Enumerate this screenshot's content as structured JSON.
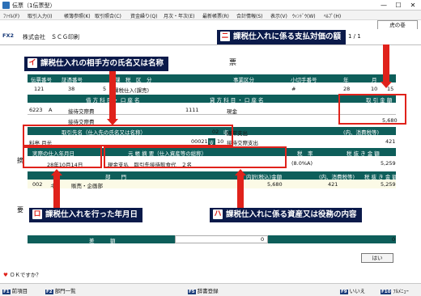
{
  "window": {
    "title": "伝票（1伝票型）",
    "min_glyph": "—",
    "max_glyph": "☐",
    "close_glyph": "✕"
  },
  "menu": [
    "ﾌｧｲﾙ(F)",
    "取引入力(I)",
    "帳簿参照(K)",
    "取引照合(C)",
    "資金繰り(Q)",
    "月次・年次(E)",
    "最新帳票(R)",
    "合計情報(S)",
    "表示(V)",
    "ｳｨﾝﾄﾞｳ(W)",
    "ﾍﾙﾌﾟ(H)"
  ],
  "tab_label": "虎の巻",
  "header": {
    "app_code": "FX2",
    "company": "株式会社　ＳＣＧ印刷",
    "voucher_no": "1 / 1"
  },
  "form": {
    "title": "票",
    "row1_headers": [
      "伝票番号",
      "証憑番号",
      "課　税　区　分",
      "事業区分",
      "小切手番号",
      "年",
      "月"
    ],
    "row1_values": [
      "121",
      "38",
      "5",
      "課税仕入(課売)",
      "#",
      "28",
      "10",
      "15"
    ],
    "debit_header": "借 方 科 目 ・ 口 座 名",
    "credit_header": "貸 方 科 目 ・ 口 座 名",
    "amount_header": "取 引 金 額",
    "debit_code": "6223",
    "debit_flag": "A",
    "debit_name": "接待交際費",
    "debit_sub": "接待交際費",
    "credit_code": "1111",
    "credit_name": "現金",
    "amount": "5,680",
    "partner_header": "取引先名（仕入先の氏名又は名称）",
    "partner_name": "料亭 月光",
    "partner_code": "000210",
    "col_shu": "収",
    "col_shi": "支",
    "div_header_code": "02",
    "div_header": "経常支出",
    "div_code": "10",
    "div_name": "接待交際支出",
    "tax_inner_header": "(内、消費税等)",
    "tax_inner_val": "421",
    "date_header": "実際の仕入年月日",
    "date_val": "28年10月14日",
    "memo_header": "元 帳 摘 要（仕入資産等の総称）",
    "memo_val": "現金支払　取引先接待飲食代　２名",
    "rate_header": "税　率",
    "rate_val": "(8.0%A)",
    "excl_header": "税 抜 き 金 額",
    "excl_val": "5,259",
    "side_tei": "摘",
    "side_yo": "要",
    "dept_header": "部　　門",
    "dept_amount_header": "内訳(税込)金額",
    "dept_tax_header": "(内、消費税等)",
    "dept_excl_header": "税 抜 き 金 額",
    "dept_code": "002",
    "dept_prefix": "ネ",
    "dept_name": "販売・企画部",
    "dept_amount": "5,680",
    "dept_tax": "421",
    "dept_excl": "5,259",
    "diff_header": "差　　　額",
    "diff_val1": "0",
    "diff_val2": "0",
    "yes_label": "はい"
  },
  "annotations": {
    "i": {
      "mark": "イ",
      "text": "課税仕入れの相手方の氏名又は名称"
    },
    "ro": {
      "mark": "ロ",
      "text": "課税仕入れを行った年月日"
    },
    "ha": {
      "mark": "ハ",
      "text": "課税仕入れに係る資産又は役務の内容"
    },
    "ni": {
      "mark": "ニ",
      "text": "課税仕入れに係る支払対価の額"
    }
  },
  "status_prompt": "ＯＫですか？",
  "fkeys": [
    {
      "key": "F1",
      "label": "前項目"
    },
    {
      "key": "F2",
      "label": "部門一覧"
    },
    {
      "key": "F5",
      "label": "辞書登録"
    },
    {
      "key": "F9",
      "label": "いいえ"
    },
    {
      "key": "F10",
      "label": "ﾌﾙﾒﾆｭｰ"
    }
  ],
  "colors": {
    "band": "#0e5e5a",
    "label_bg": "#0b1a4a",
    "accent": "#e0221b"
  }
}
